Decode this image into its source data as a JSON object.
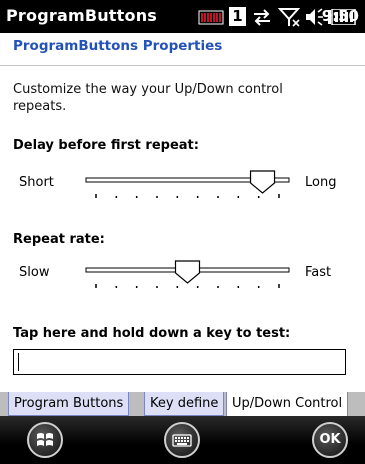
{
  "status_bar": {
    "app_title": "ProgramButtons",
    "time": "9:50",
    "sim_number": "1",
    "icons": [
      "signal-bars-icon",
      "sim-slot-icon",
      "data-transfer-icon",
      "no-signal-icon",
      "volume-icon",
      "battery-icon"
    ]
  },
  "app": {
    "title": "ProgramButtons Properties"
  },
  "description": "Customize the way your Up/Down control repeats.",
  "delay": {
    "heading": "Delay before first repeat:",
    "min_label": "Short",
    "max_label": "Long",
    "value_fraction": 0.91,
    "tick_count": 10
  },
  "rate": {
    "heading": "Repeat rate:",
    "min_label": "Slow",
    "max_label": "Fast",
    "value_fraction": 0.5,
    "tick_count": 10
  },
  "test": {
    "heading": "Tap here and hold down a key to test:",
    "value": ""
  },
  "tabs": [
    {
      "label": "Program Buttons",
      "active": false
    },
    {
      "label": "Key define",
      "active": false
    },
    {
      "label": "Up/Down Control",
      "active": true
    }
  ],
  "soft_keys": {
    "left_icon": "windows-start-icon",
    "center_icon": "keyboard-icon",
    "right_label": "OK"
  },
  "colors": {
    "title_blue": "#2352b8",
    "tab_inactive": "#dcdff6",
    "tab_border": "#7a86c6"
  }
}
